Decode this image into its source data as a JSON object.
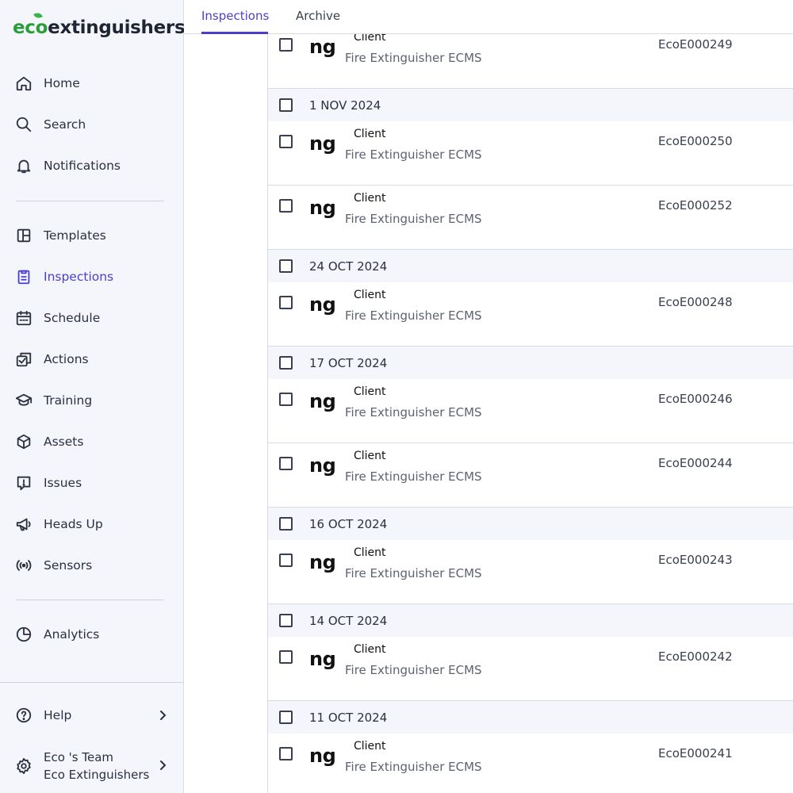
{
  "logo": {
    "prefix": "eco",
    "suffix": "extinguishers"
  },
  "nav": {
    "home": "Home",
    "search": "Search",
    "notifications": "Notifications",
    "templates": "Templates",
    "inspections": "Inspections",
    "schedule": "Schedule",
    "actions": "Actions",
    "training": "Training",
    "assets": "Assets",
    "issues": "Issues",
    "heads_up": "Heads Up",
    "sensors": "Sensors",
    "analytics": "Analytics",
    "help": "Help",
    "team_name": "Eco 's Team",
    "team_org": "Eco Extinguishers"
  },
  "tabs": {
    "inspections": "Inspections",
    "archive": "Archive"
  },
  "accent_color": "#4b3fd1",
  "rows": [
    {
      "type": "item",
      "thumb": "ng",
      "client": "Client",
      "subtitle": "Fire Extinguisher ECMS",
      "code": "EcoE000249"
    },
    {
      "type": "group",
      "label": "1 NOV 2024"
    },
    {
      "type": "item",
      "thumb": "ng",
      "client": "Client",
      "subtitle": "Fire Extinguisher ECMS",
      "code": "EcoE000250"
    },
    {
      "type": "item",
      "thumb": "ng",
      "client": "Client",
      "subtitle": "Fire Extinguisher ECMS",
      "code": "EcoE000252"
    },
    {
      "type": "group",
      "label": "24 OCT 2024"
    },
    {
      "type": "item",
      "thumb": "ng",
      "client": "Client",
      "subtitle": "Fire Extinguisher ECMS",
      "code": "EcoE000248"
    },
    {
      "type": "group",
      "label": "17 OCT 2024"
    },
    {
      "type": "item",
      "thumb": "ng",
      "client": "Client",
      "subtitle": "Fire Extinguisher ECMS",
      "code": "EcoE000246"
    },
    {
      "type": "item",
      "thumb": "ng",
      "client": "Client",
      "subtitle": "Fire Extinguisher ECMS",
      "code": "EcoE000244"
    },
    {
      "type": "group",
      "label": "16 OCT 2024"
    },
    {
      "type": "item",
      "thumb": "ng",
      "client": "Client",
      "subtitle": "Fire Extinguisher ECMS",
      "code": "EcoE000243"
    },
    {
      "type": "group",
      "label": "14 OCT 2024"
    },
    {
      "type": "item",
      "thumb": "ng",
      "client": "Client",
      "subtitle": "Fire Extinguisher ECMS",
      "code": "EcoE000242"
    },
    {
      "type": "group",
      "label": "11 OCT 2024"
    },
    {
      "type": "item",
      "thumb": "ng",
      "client": "Client",
      "subtitle": "Fire Extinguisher ECMS",
      "code": "EcoE000241"
    }
  ]
}
